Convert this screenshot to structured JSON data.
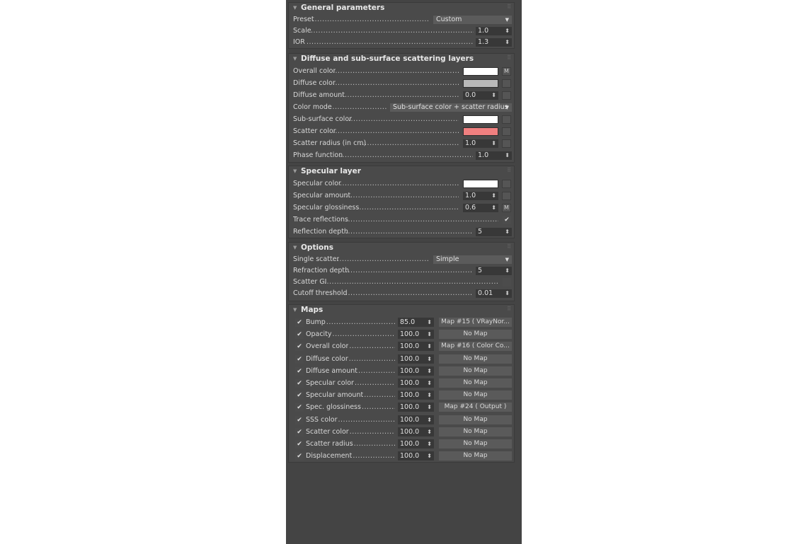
{
  "general": {
    "title": "General parameters",
    "preset_label": "Preset",
    "preset_value": "Custom",
    "scale_label": "Scale",
    "scale_value": "1.0",
    "ior_label": "IOR",
    "ior_value": "1.3"
  },
  "diffuse": {
    "title": "Diffuse and sub-surface scattering layers",
    "overall_color_label": "Overall color",
    "overall_color": "#ffffff",
    "overall_map_btn": "M",
    "diffuse_color_label": "Diffuse color",
    "diffuse_color": "#b9b9b9",
    "diffuse_amount_label": "Diffuse amount",
    "diffuse_amount_value": "0.0",
    "color_mode_label": "Color mode",
    "color_mode_value": "Sub-surface color + scatter radius",
    "sss_color_label": "Sub-surface color",
    "sss_color": "#ffffff",
    "scatter_color_label": "Scatter color",
    "scatter_color": "#f08080",
    "scatter_radius_label": "Scatter radius (in cm)",
    "scatter_radius_value": "1.0",
    "phase_function_label": "Phase function",
    "phase_function_value": "1.0"
  },
  "specular": {
    "title": "Specular layer",
    "color_label": "Specular color",
    "color": "#ffffff",
    "amount_label": "Specular amount",
    "amount_value": "1.0",
    "gloss_label": "Specular glossiness",
    "gloss_value": "0.6",
    "gloss_map_btn": "M",
    "trace_label": "Trace reflections",
    "trace_checked": true,
    "depth_label": "Reflection depth",
    "depth_value": "5"
  },
  "options": {
    "title": "Options",
    "single_scatter_label": "Single scatter",
    "single_scatter_value": "Simple",
    "refraction_depth_label": "Refraction depth",
    "refraction_depth_value": "5",
    "scatter_gi_label": "Scatter GI",
    "scatter_gi_checked": false,
    "cutoff_label": "Cutoff threshold",
    "cutoff_value": "0.01"
  },
  "maps": {
    "title": "Maps",
    "rows": [
      {
        "label": "Bump",
        "value": "85.0",
        "map": "Map #15  ( VRayNor...",
        "checked": true
      },
      {
        "label": "Opacity",
        "value": "100.0",
        "map": "No Map",
        "checked": true
      },
      {
        "label": "Overall color",
        "value": "100.0",
        "map": "Map #16  ( Color Co...",
        "checked": true
      },
      {
        "label": "Diffuse color",
        "value": "100.0",
        "map": "No Map",
        "checked": true
      },
      {
        "label": "Diffuse amount",
        "value": "100.0",
        "map": "No Map",
        "checked": true
      },
      {
        "label": "Specular color",
        "value": "100.0",
        "map": "No Map",
        "checked": true
      },
      {
        "label": "Specular amount",
        "value": "100.0",
        "map": "No Map",
        "checked": true
      },
      {
        "label": "Spec. glossiness",
        "value": "100.0",
        "map": "Map #24  ( Output )",
        "checked": true
      },
      {
        "label": "SSS color",
        "value": "100.0",
        "map": "No Map",
        "checked": true
      },
      {
        "label": "Scatter color",
        "value": "100.0",
        "map": "No Map",
        "checked": true
      },
      {
        "label": "Scatter radius",
        "value": "100.0",
        "map": "No Map",
        "checked": true
      },
      {
        "label": "Displacement",
        "value": "100.0",
        "map": "No Map",
        "checked": true
      }
    ]
  },
  "icons": {
    "collapse": "triangle-down-icon",
    "spinner": "up-down-spinner-icon",
    "dropdown": "dropdown-arrow-icon",
    "check": "checkmark-icon",
    "grip": "drag-grip-icon"
  }
}
